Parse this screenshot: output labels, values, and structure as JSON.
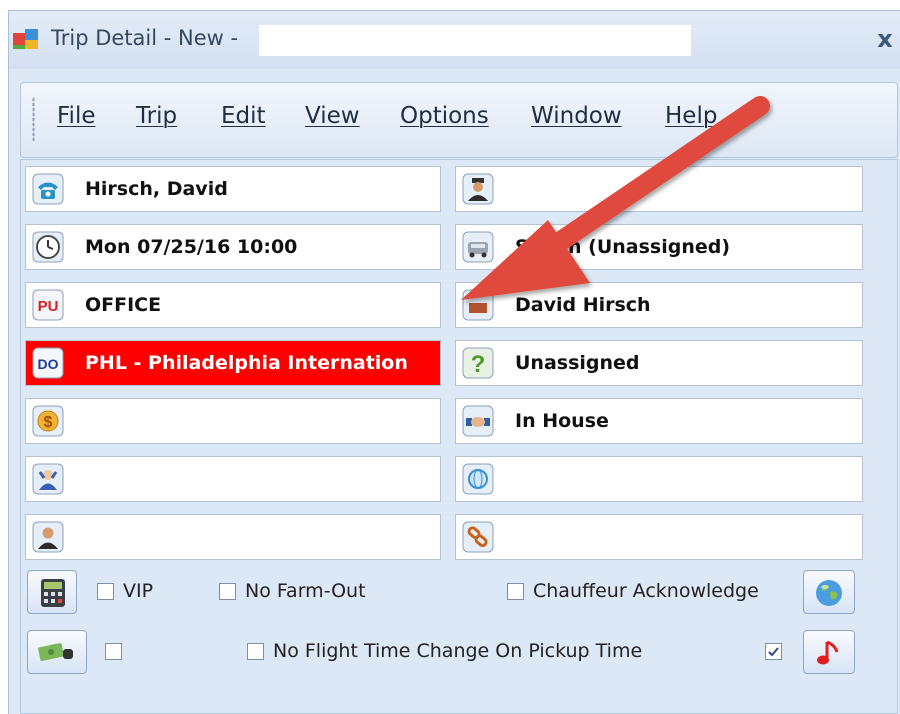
{
  "window": {
    "title": "Trip Detail - New -",
    "close_glyph": "x"
  },
  "menu": [
    "File",
    "Trip",
    "Edit",
    "View",
    "Options",
    "Window",
    "Help"
  ],
  "left_fields": [
    {
      "icon": "phone-icon",
      "value": "Hirsch, David"
    },
    {
      "icon": "clock-icon",
      "value": "Mon 07/25/16 10:00"
    },
    {
      "icon": "pickup-icon",
      "badge": "PU",
      "value": "OFFICE"
    },
    {
      "icon": "dropoff-icon",
      "badge": "DO",
      "value": "PHL - Philadelphia Internation"
    },
    {
      "icon": "dollar-icon",
      "value": ""
    },
    {
      "icon": "passenger-icon",
      "value": ""
    },
    {
      "icon": "person-icon",
      "value": ""
    }
  ],
  "right_fields": [
    {
      "icon": "driver-icon",
      "value": ""
    },
    {
      "icon": "car-icon",
      "value": "Sedan (Unassigned)"
    },
    {
      "icon": "vehicle-icon",
      "value": "David Hirsch"
    },
    {
      "icon": "question-icon",
      "value": "Unassigned"
    },
    {
      "icon": "handshake-icon",
      "value": "In House"
    },
    {
      "icon": "globe-small-icon",
      "value": ""
    },
    {
      "icon": "link-icon",
      "value": ""
    }
  ],
  "checkboxes": {
    "vip": {
      "label": "VIP",
      "checked": false
    },
    "no_farm_out": {
      "label": "No Farm-Out",
      "checked": false
    },
    "chauffeur_ack": {
      "label": "Chauffeur Acknowledge",
      "checked": false
    },
    "unlabeled": {
      "label": "",
      "checked": false
    },
    "no_flight_change": {
      "label": "No Flight Time Change On Pickup Time",
      "checked": false
    },
    "right_check": {
      "label": "",
      "checked": true
    }
  },
  "colors": {
    "dropoff_bg": "#ff0000",
    "arrow": "#e04a3c",
    "window_bg": "#dde8f6"
  }
}
